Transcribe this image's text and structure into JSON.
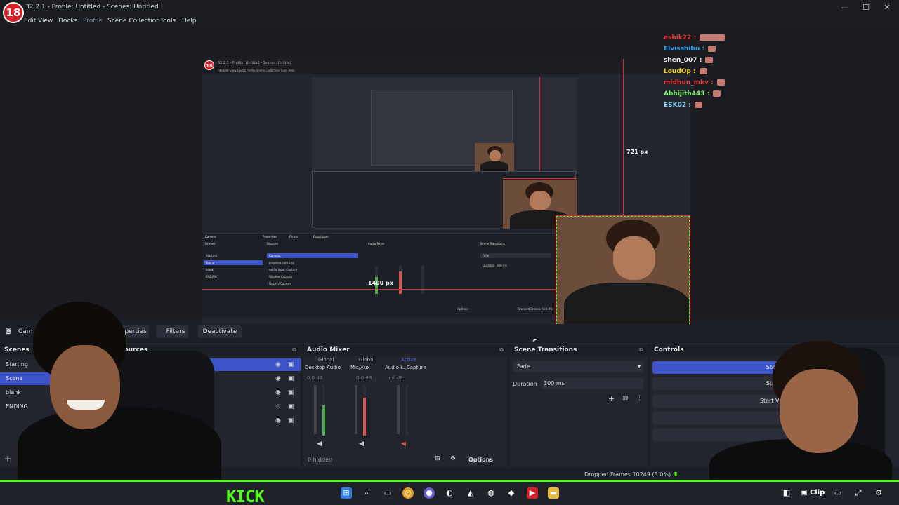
{
  "window": {
    "title": "32.2.1 - Profile: Untitled - Scenes: Untitled",
    "logo_text": "18",
    "controls": [
      "—",
      "☐",
      "✕"
    ]
  },
  "menu": {
    "items": [
      "Edit",
      "View",
      "Docks",
      "Profile",
      "Scene Collection",
      "Tools",
      "Help"
    ]
  },
  "preview": {
    "measure_vertical": "721 px",
    "measure_horizontal": "1400 px",
    "nested_title": "32.2.1 - Profile: Untitled - Scenes: Untitled",
    "nested_menu": "File  Edit  View  Docks  Profile  Scene Collection  Tools  Help",
    "mini_docks": {
      "headers": [
        "Scenes",
        "Sources",
        "Audio Mixer",
        "Scene Transitions",
        "Controls"
      ],
      "scenes": [
        "Starting",
        "Scene",
        "blank",
        "ENDING"
      ],
      "sources": [
        "Camera",
        "pngwing.com.png",
        "Audio Input Capture",
        "Window Capture",
        "Display Capture"
      ],
      "toolbar": [
        "Camera",
        "Properties",
        "Filters",
        "Deactivate"
      ],
      "transition": "Fade",
      "duration_label": "Duration",
      "duration": "300 ms",
      "dropped": "Dropped Frames 0 (0.0%)",
      "options": "Options"
    }
  },
  "chat": {
    "messages": [
      {
        "user": "ashik22",
        "color": "#e2383a"
      },
      {
        "user": "Elvisshibu",
        "color": "#33a7f0"
      },
      {
        "user": "shen_007",
        "color": "#f0f0f0"
      },
      {
        "user": "LoudOp",
        "color": "#f5d800"
      },
      {
        "user": "midhun_mkv",
        "color": "#e2383a"
      },
      {
        "user": "Abhijith443",
        "color": "#7df06e"
      },
      {
        "user": "ESK02",
        "color": "#7fd6f0"
      }
    ]
  },
  "toolbar": {
    "camera_label": "Cam",
    "properties_label": "Properties",
    "filters_label": "Filters",
    "deactivate_label": "Deactivate"
  },
  "scenes": {
    "title": "Scenes",
    "items": [
      "Starting",
      "Scene",
      "blank",
      "ENDING"
    ],
    "selected_index": 1,
    "add_label": "+"
  },
  "sources": {
    "title": "Sources"
  },
  "audio_mixer": {
    "title": "Audio Mixer",
    "tabs": [
      "Global",
      "Global",
      "Active"
    ],
    "channels": [
      {
        "name": "Desktop Audio",
        "db": "0.0 dB",
        "level": 0.6
      },
      {
        "name": "Mic/Aux",
        "db": "0.0 dB",
        "level": 0.75
      },
      {
        "name": "Audio I...Capture",
        "db": "-inf dB",
        "level": 0.0
      }
    ],
    "hidden": "0 hidden",
    "options": "Options"
  },
  "transitions": {
    "title": "Scene Transitions",
    "selected": "Fade",
    "duration_label": "Duration",
    "duration": "300 ms"
  },
  "controls": {
    "title": "Controls",
    "buttons": [
      "Stop Str",
      "Start Re",
      "Start Virtu",
      "St"
    ]
  },
  "status": {
    "dropped": "Dropped Frames 10249 (3.0%)"
  },
  "overlay": {
    "kick": "KICK"
  },
  "stream_taskbar": {
    "clip_label": "Clip"
  }
}
